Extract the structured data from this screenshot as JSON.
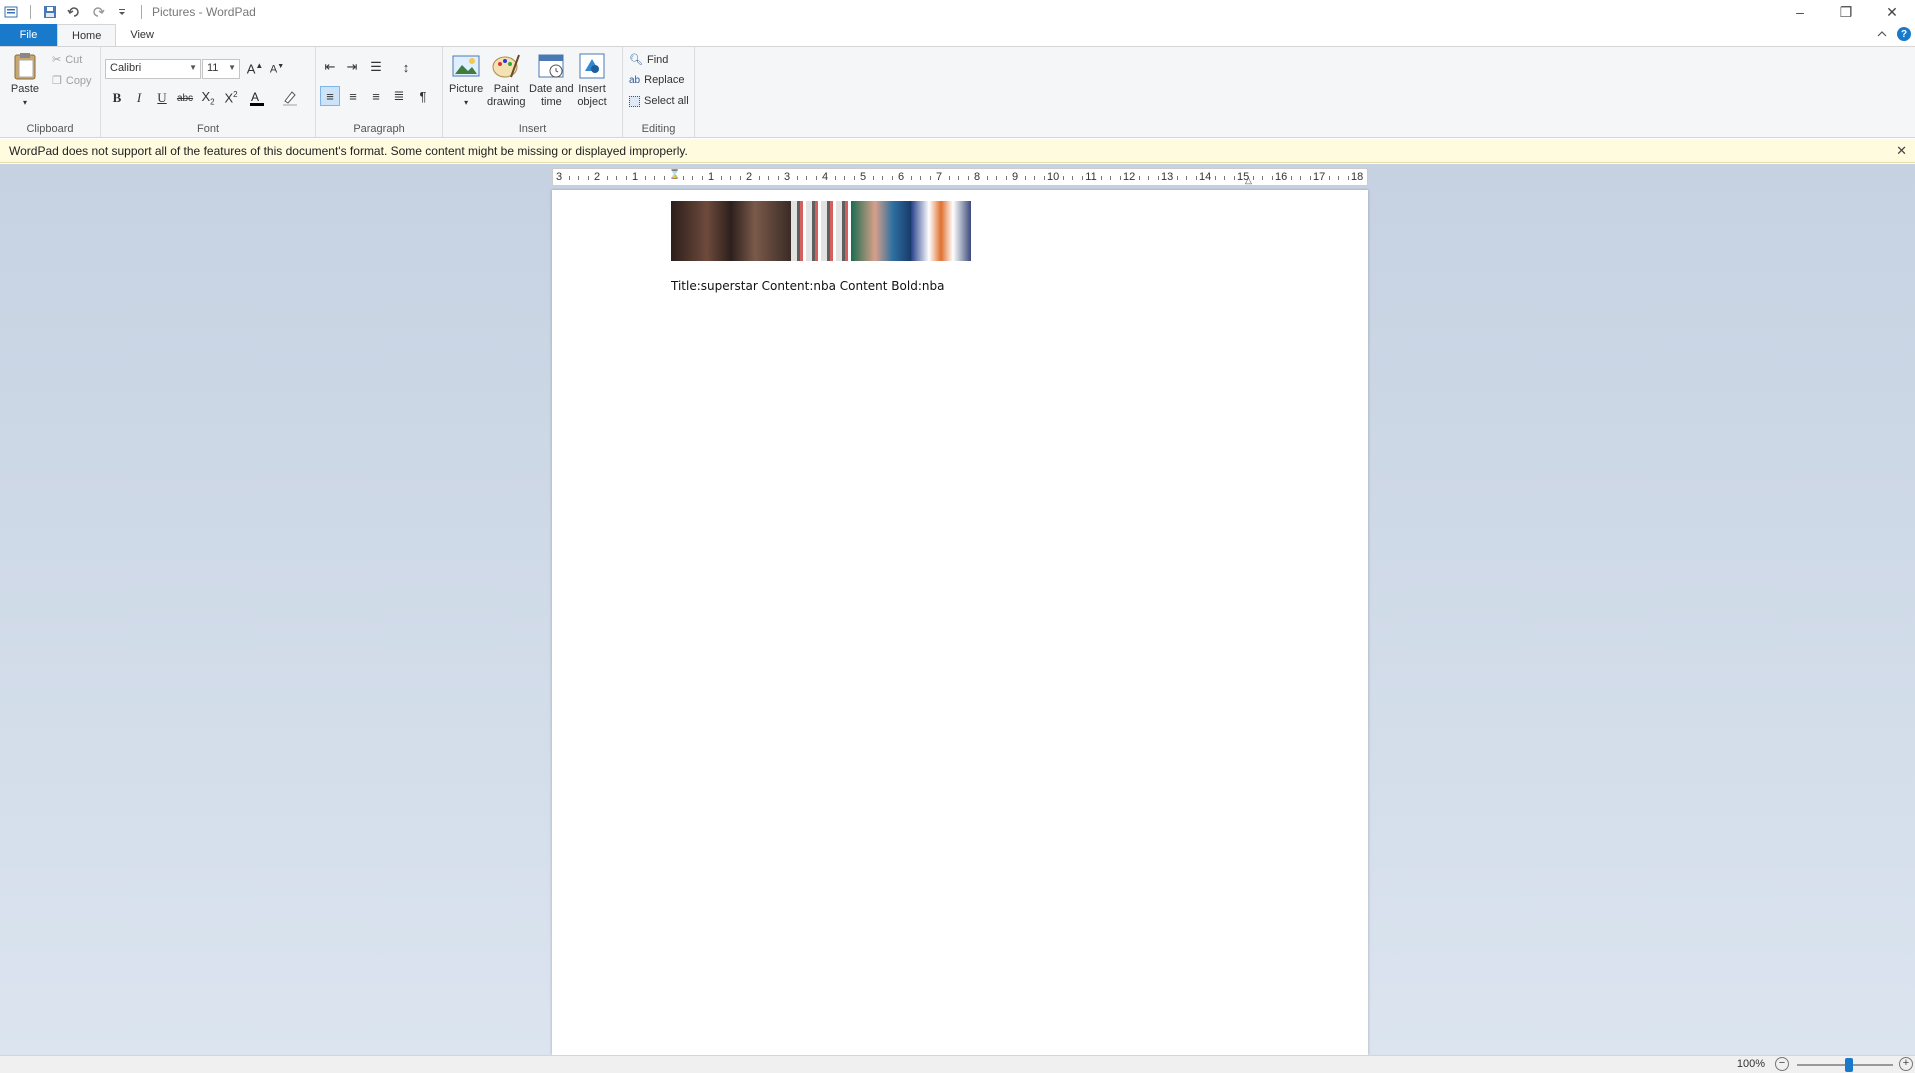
{
  "window": {
    "title": "Pictures - WordPad",
    "controls": {
      "minimize": "–",
      "restore": "❐",
      "close": "✕"
    }
  },
  "tabs": [
    {
      "label": "File"
    },
    {
      "label": "Home"
    },
    {
      "label": "View"
    }
  ],
  "ribbon": {
    "clipboard": {
      "label": "Clipboard",
      "paste": "Paste",
      "cut": "Cut",
      "copy": "Copy"
    },
    "font": {
      "label": "Font",
      "family": "Calibri",
      "size": "11"
    },
    "paragraph": {
      "label": "Paragraph"
    },
    "insert": {
      "label": "Insert",
      "picture": "Picture",
      "paint_line1": "Paint",
      "paint_line2": "drawing",
      "datetime_line1": "Date and",
      "datetime_line2": "time",
      "object_line1": "Insert",
      "object_line2": "object"
    },
    "editing": {
      "label": "Editing",
      "find": "Find",
      "replace": "Replace",
      "select_all": "Select all"
    }
  },
  "infobar": {
    "message": "WordPad does not support all of the features of this document's format. Some content might be missing or displayed improperly."
  },
  "ruler": {
    "labels": [
      "3",
      "2",
      "1",
      "",
      "1",
      "2",
      "3",
      "4",
      "5",
      "6",
      "7",
      "8",
      "9",
      "10",
      "11",
      "12",
      "13",
      "14",
      "15",
      "16",
      "17",
      "18"
    ]
  },
  "document": {
    "text": "Title:superstar Content:nba Content Bold:nba"
  },
  "status": {
    "zoom": "100%"
  },
  "colors": {
    "accent": "#1979ca",
    "infobar_bg": "#fffbdf",
    "workarea_bg": "#c6d2e2"
  }
}
